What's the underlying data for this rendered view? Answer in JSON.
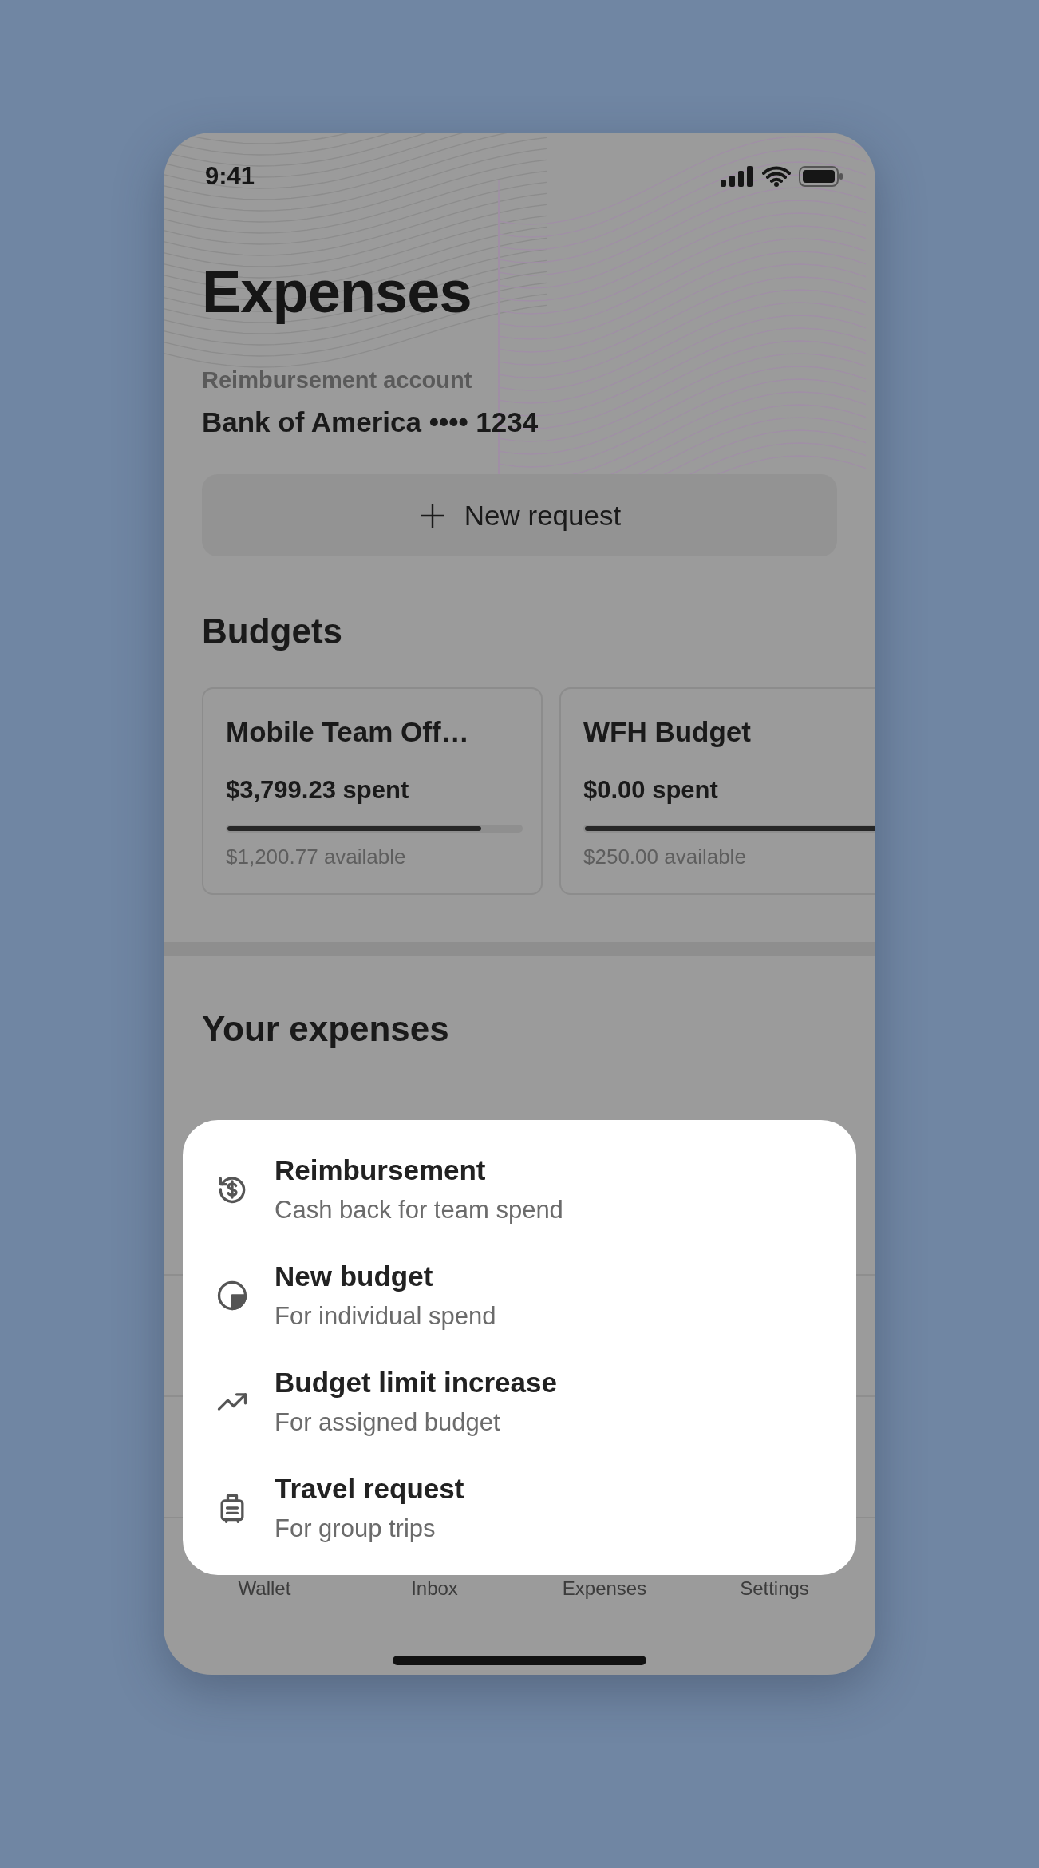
{
  "status_bar": {
    "time": "9:41"
  },
  "header": {
    "title": "Expenses",
    "account_label": "Reimbursement account",
    "account_value": "Bank of America •••• 1234"
  },
  "new_request_button": {
    "label": "New request"
  },
  "budgets": {
    "title": "Budgets",
    "cards": [
      {
        "name": "Mobile Team Off…",
        "spent": "$3,799.23 spent",
        "level": 0.865,
        "available": "$1,200.77 available"
      },
      {
        "name": "WFH Budget",
        "spent": "$0.00 spent",
        "level": 1,
        "available": "$250.00 available"
      }
    ]
  },
  "expenses": {
    "title": "Your expenses"
  },
  "tab_bar": {
    "tabs": [
      {
        "label": "Wallet"
      },
      {
        "label": "Inbox"
      },
      {
        "label": "Expenses"
      },
      {
        "label": "Settings"
      }
    ]
  },
  "sheet": {
    "options": [
      {
        "kind": "reimbursement",
        "title": "Reimbursement",
        "subtitle": "Cash back for team spend"
      },
      {
        "kind": "budget",
        "title": "New budget",
        "subtitle": "For individual spend"
      },
      {
        "kind": "increase",
        "title": "Budget limit increase",
        "subtitle": "For assigned budget"
      },
      {
        "kind": "travel",
        "title": "Travel request",
        "subtitle": "For group trips"
      }
    ]
  }
}
